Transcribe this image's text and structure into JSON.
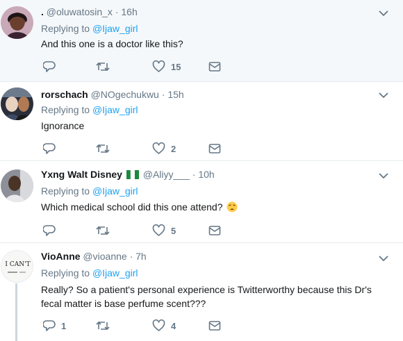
{
  "tweets": [
    {
      "name": ".",
      "handle": "@oluwatosin_x",
      "dot": "·",
      "time": "16h",
      "replying_prefix": "Replying to",
      "replying_to": "@Ijaw_girl",
      "text": "And this one is a doctor like this?",
      "reply_count": "",
      "retweet_count": "",
      "like_count": "15"
    },
    {
      "name": "rorschach",
      "handle": "@NOgechukwu",
      "dot": "·",
      "time": "15h",
      "replying_prefix": "Replying to",
      "replying_to": "@Ijaw_girl",
      "text": "Ignorance",
      "reply_count": "",
      "retweet_count": "",
      "like_count": "2"
    },
    {
      "name": "Yxng Walt Disney",
      "handle": "@Aliyy___",
      "dot": "·",
      "time": "10h",
      "replying_prefix": "Replying to",
      "replying_to": "@Ijaw_girl",
      "text": "Which medical school did this one attend?",
      "reply_count": "",
      "retweet_count": "",
      "like_count": "5"
    },
    {
      "name": "VioAnne",
      "handle": "@vioanne",
      "dot": "·",
      "time": "7h",
      "replying_prefix": "Replying to",
      "replying_to": "@Ijaw_girl",
      "text": "Really? So a patient's personal experience is Twitterworthy because this Dr's fecal matter is base perfume scent???",
      "reply_count": "1",
      "retweet_count": "",
      "like_count": "4",
      "avatar_text": "I CAN'T"
    }
  ],
  "icons": {
    "reply": "reply-icon",
    "retweet": "retweet-icon",
    "like": "heart-icon",
    "dm": "envelope-icon",
    "more": "chevron-down-icon",
    "flag": "nigeria-flag-icon",
    "emoji": "weary-face-emoji"
  },
  "colors": {
    "link": "#1da1f2",
    "secondary": "#657786",
    "highlight_bg": "#f5f8fa",
    "border": "#e6ecf0"
  }
}
